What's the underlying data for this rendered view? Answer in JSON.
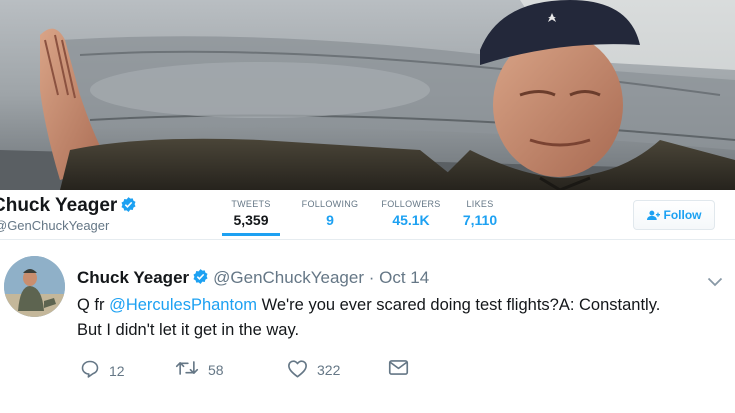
{
  "profile": {
    "name": "Chuck Yeager",
    "handle": "@GenChuckYeager",
    "follow_label": "Follow",
    "stats": [
      {
        "label": "TWEETS",
        "value": "5,359"
      },
      {
        "label": "FOLLOWING",
        "value": "9"
      },
      {
        "label": "FOLLOWERS",
        "value": "45.1K"
      },
      {
        "label": "LIKES",
        "value": "7,110"
      }
    ]
  },
  "tweet": {
    "author": "Chuck Yeager",
    "handle": "@GenChuckYeager",
    "separator": "·",
    "date": "Oct 14",
    "text_prefix": "Q fr ",
    "mention": "@HerculesPhantom",
    "text_line1": " We're you ever scared doing test flights?A: Constantly.",
    "text_line2": "But I didn't let it get in the way.",
    "replies": "12",
    "retweets": "58",
    "likes": "322"
  },
  "icons": {
    "verified": "verified-badge-icon",
    "follow": "add-user-icon",
    "reply": "reply-icon",
    "retweet": "retweet-icon",
    "like": "heart-icon",
    "dm": "envelope-icon",
    "more": "chevron-down-icon"
  },
  "colors": {
    "accent": "#1da1f2",
    "text": "#14171a",
    "muted": "#657786"
  }
}
